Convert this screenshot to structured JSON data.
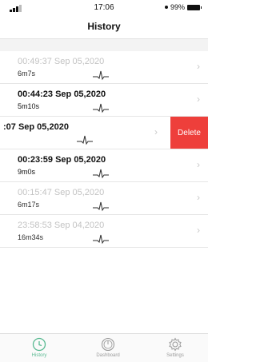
{
  "status_bar": {
    "time": "17:06",
    "battery": "99%"
  },
  "header": {
    "title": "History"
  },
  "records": [
    {
      "timestamp": "00:49:37 Sep 05,2020",
      "duration": "6m7s",
      "style": "faded"
    },
    {
      "timestamp": "00:44:23 Sep 05,2020",
      "duration": "5m10s",
      "style": "bold"
    },
    {
      "timestamp": ":07 Sep 05,2020",
      "duration": "",
      "style": "swiped"
    },
    {
      "timestamp": "00:23:59 Sep 05,2020",
      "duration": "9m0s",
      "style": "bold"
    },
    {
      "timestamp": "00:15:47 Sep 05,2020",
      "duration": "6m17s",
      "style": "faded"
    },
    {
      "timestamp": "23:58:53 Sep 04,2020",
      "duration": "16m34s",
      "style": "faded"
    }
  ],
  "actions": {
    "delete_label": "Delete"
  },
  "tabbar": {
    "tabs": [
      {
        "label": "History",
        "icon": "clock-icon",
        "active": true
      },
      {
        "label": "Dashboard",
        "icon": "gauge-icon",
        "active": false
      },
      {
        "label": "Settings",
        "icon": "gear-icon",
        "active": false
      }
    ]
  },
  "colors": {
    "accent": "#58b991",
    "delete": "#ee3f3b"
  }
}
